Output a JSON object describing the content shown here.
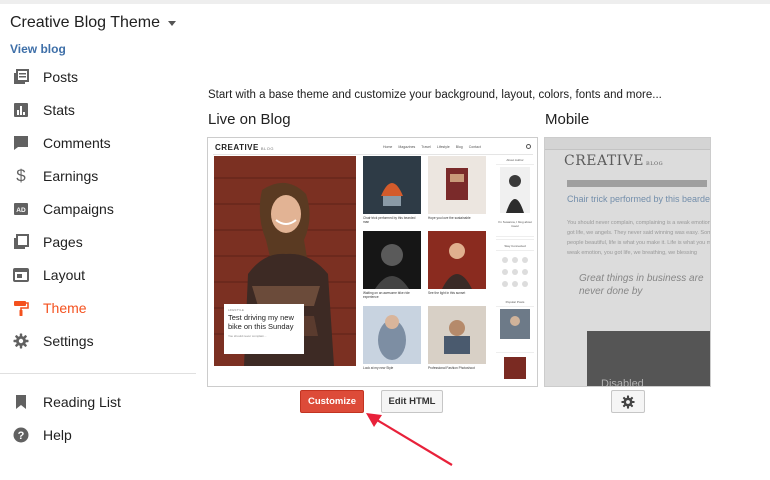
{
  "header": {
    "blog_title": "Creative Blog Theme",
    "view_blog": "View blog"
  },
  "sidebar": {
    "items": [
      {
        "label": "Posts",
        "icon": "posts-icon"
      },
      {
        "label": "Stats",
        "icon": "stats-icon"
      },
      {
        "label": "Comments",
        "icon": "comments-icon"
      },
      {
        "label": "Earnings",
        "icon": "dollar-icon"
      },
      {
        "label": "Campaigns",
        "icon": "ad-icon"
      },
      {
        "label": "Pages",
        "icon": "pages-icon"
      },
      {
        "label": "Layout",
        "icon": "layout-icon"
      },
      {
        "label": "Theme",
        "icon": "paint-roller-icon",
        "active": true
      },
      {
        "label": "Settings",
        "icon": "gear-icon"
      }
    ],
    "lower_items": [
      {
        "label": "Reading List",
        "icon": "bookmark-icon"
      },
      {
        "label": "Help",
        "icon": "help-icon"
      }
    ]
  },
  "main": {
    "intro": "Start with a base theme and customize your background, layout, colors, fonts and more...",
    "live_title": "Live on Blog",
    "mobile_title": "Mobile",
    "customize_label": "Customize",
    "edit_html_label": "Edit HTML"
  },
  "live_preview": {
    "logo": "CREATIVE",
    "logo_suffix": "BLOG",
    "nav": [
      "Home",
      "Magazines",
      "Travel",
      "Lifestyle",
      "Blog",
      "Contact"
    ],
    "hero_tag": "LIFESTYLE",
    "hero_title": "Test driving my new bike on this Sunday",
    "hero_sub": "You should never complain...",
    "captions": [
      "Chair trick performed by this bearded man",
      "Hope you love the sustainable",
      "Waiting on an awesome bike ride experience",
      "See the light in this sunset",
      "Look at my new Style",
      "Professional Fashion Photoshoot"
    ],
    "side_heading_1": "About Author",
    "side_name": "I'm Susanna, I blog about travel",
    "side_heading_2": "Stay Connected",
    "side_heading_3": "Popular Posts"
  },
  "mobile_preview": {
    "logo": "CREATIVE",
    "logo_suffix": "BLOG",
    "post_title": "Chair trick performed by this bearded",
    "body": "You should never complain, complaining is a weak emotion, you got life, we angels. They never said winning was easy. Some people beautiful, life is what you make it. Life is what you make it weak emotion, you got life, we breathing, we blessing",
    "quote": "Great things in business are never done by",
    "disabled": "Disabled"
  }
}
